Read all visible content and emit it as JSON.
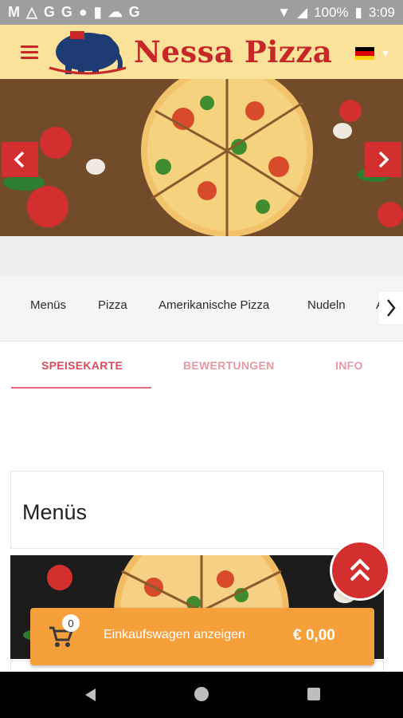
{
  "status_bar": {
    "icons": [
      "gmail-icon",
      "drive-icon",
      "google-icon",
      "google-icon",
      "circle-icon",
      "sd-card-icon",
      "cloud-icon",
      "google-icon"
    ],
    "battery": "100%",
    "time": "3:09"
  },
  "header": {
    "brand": "Nessa Pizza",
    "flag_colors": [
      "#000000",
      "#dd0000",
      "#ffce00"
    ]
  },
  "banner": {
    "prev_icon": "chevron-left-icon",
    "next_icon": "chevron-right-icon"
  },
  "categories": {
    "items": [
      "Menüs",
      "Pizza",
      "Amerikanische Pizza",
      "Nudeln",
      "A"
    ]
  },
  "tabs": [
    {
      "label": "SPEISEKARTE"
    },
    {
      "label": "BEWERTUNGEN"
    },
    {
      "label": "INFO"
    }
  ],
  "section": {
    "title": "Menüs"
  },
  "cart": {
    "count": "0",
    "label": "Einkaufswagen anzeigen",
    "total": "€ 0,00"
  },
  "colors": {
    "header_bg": "#fbe29b",
    "brand_red": "#c62828",
    "accent_red": "#d32f2f",
    "tab_active": "#d94b5c",
    "cart_orange": "#f5a03a"
  }
}
